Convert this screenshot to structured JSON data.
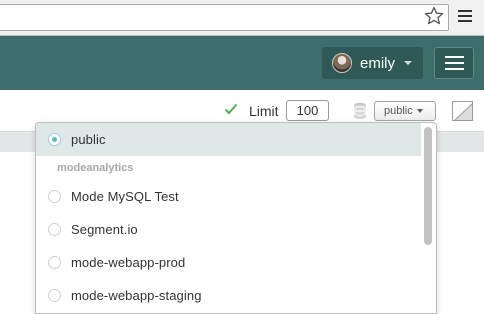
{
  "browser": {
    "star_icon": "star-outline-icon",
    "menu_icon": "chrome-menu-icon"
  },
  "header": {
    "username": "emily",
    "menu_icon": "hamburger-icon"
  },
  "toolbar": {
    "run_status_icon": "check-icon",
    "run_status_color": "#4caf50",
    "limit_label": "Limit",
    "limit_value": "100",
    "database_icon": "database-icon",
    "schema_selected": "public",
    "layout_toggle_icon": "split-view-icon"
  },
  "dropdown": {
    "selected": {
      "label": "public",
      "checked": true
    },
    "group": "modeanalytics",
    "items": [
      {
        "label": "Mode MySQL Test"
      },
      {
        "label": "Segment.io"
      },
      {
        "label": "mode-webapp-prod"
      },
      {
        "label": "mode-webapp-staging"
      }
    ]
  },
  "colors": {
    "header_bg": "#3e6e6b",
    "header_button_bg": "#2e5956",
    "selected_row_bg": "#dfe8e7",
    "radio_checked": "#5fb3d0"
  }
}
